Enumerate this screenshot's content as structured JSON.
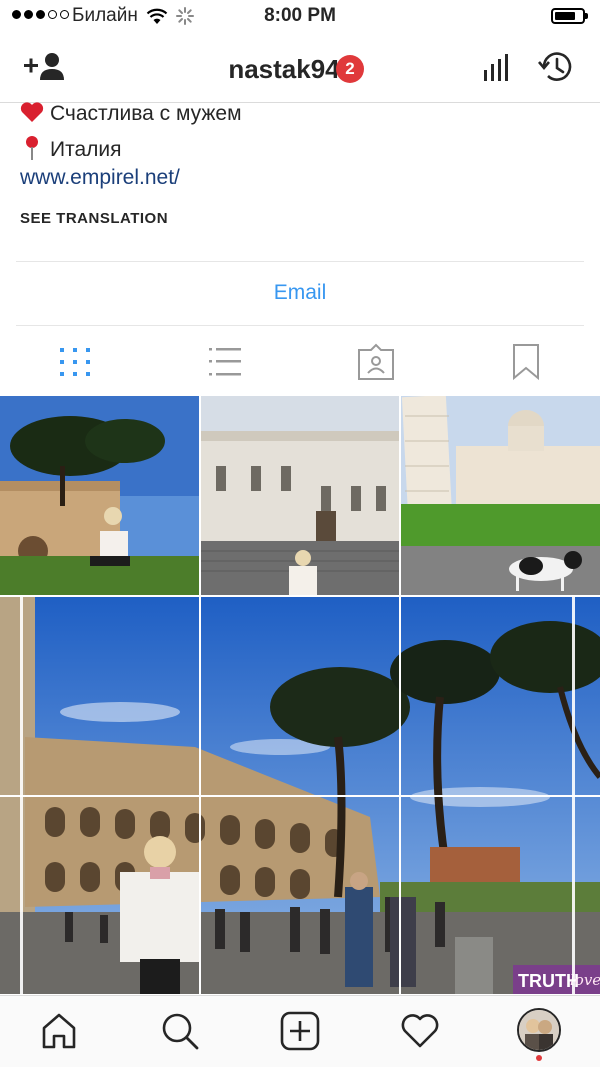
{
  "status_bar": {
    "carrier": "Билайн",
    "time": "8:00 PM"
  },
  "header": {
    "username": "nastak94",
    "badge_count": "2"
  },
  "bio": {
    "line1": "Счастлива с мужем",
    "line2": "Италия",
    "website": "www.empirel.net/",
    "see_translation": "SEE TRANSLATION"
  },
  "email_button": "Email",
  "posts": {
    "overlay_text": "TRUTH",
    "overlay_script": "love"
  },
  "colors": {
    "accent": "#3897f0",
    "badge": "#e0393b",
    "link": "#1b3f7a"
  },
  "icons": [
    "add-user-icon",
    "insights-icon",
    "archive-icon",
    "grid-icon",
    "list-icon",
    "tagged-icon",
    "saved-icon",
    "home-icon",
    "search-icon",
    "new-post-icon",
    "activity-icon",
    "profile-avatar"
  ]
}
